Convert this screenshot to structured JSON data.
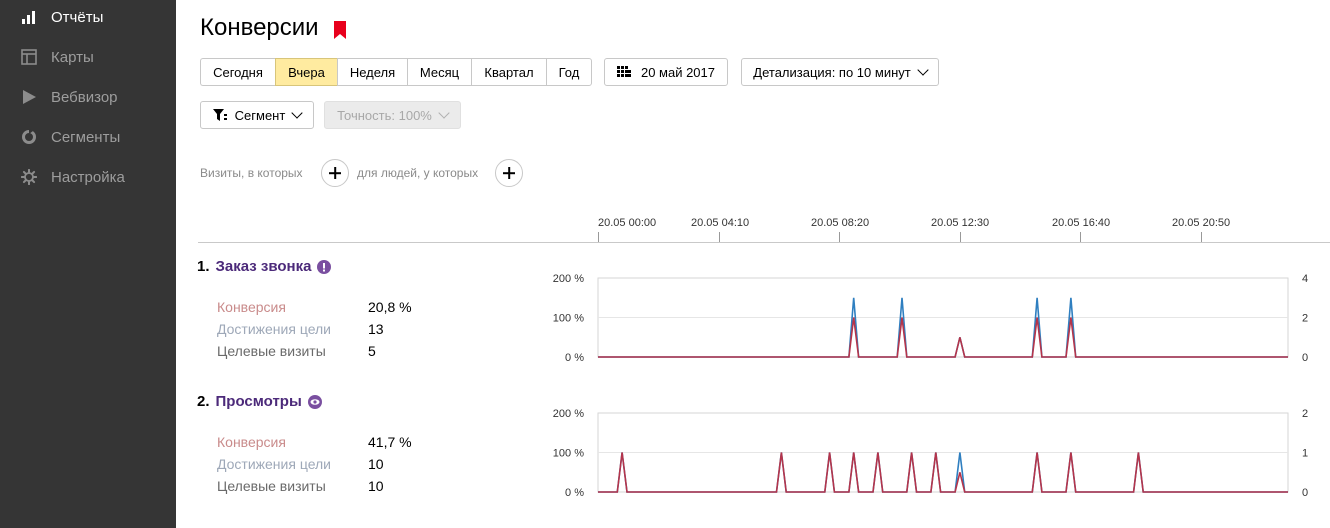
{
  "sidebar": {
    "items": [
      {
        "label": "Отчёты",
        "icon": "bar-chart-icon",
        "active": true
      },
      {
        "label": "Карты",
        "icon": "map-layout-icon",
        "active": false
      },
      {
        "label": "Вебвизор",
        "icon": "play-icon",
        "active": false
      },
      {
        "label": "Сегменты",
        "icon": "pie-segment-icon",
        "active": false
      },
      {
        "label": "Настройка",
        "icon": "gear-icon",
        "active": false
      }
    ]
  },
  "header": {
    "title": "Конверсии",
    "bookmark_icon": "bookmark-icon",
    "bookmark_color": "#e8001c"
  },
  "period": {
    "options": [
      "Сегодня",
      "Вчера",
      "Неделя",
      "Месяц",
      "Квартал",
      "Год"
    ],
    "selected": "Вчера",
    "date_label": "20 май 2017",
    "date_icon": "calendar-icon",
    "detail_label": "Детализация: по 10 минут"
  },
  "segment": {
    "label": "Сегмент",
    "icon": "funnel-icon",
    "accuracy_label": "Точность: 100%"
  },
  "filters": {
    "visits_label": "Визиты, в которых",
    "people_label": "для людей, у которых"
  },
  "timeline": {
    "labels": [
      "20.05 00:00",
      "20.05 04:10",
      "20.05 08:20",
      "20.05 12:30",
      "20.05 16:40",
      "20.05 20:50"
    ]
  },
  "colors": {
    "accent_selected": "#ffeba0",
    "goal_title": "#4c2a7a",
    "conversion_line": "#b5344a",
    "visits_line": "#2f7fc0"
  },
  "goals": [
    {
      "index": "1.",
      "name": "Заказ звонка",
      "icon": "exclamation-circle-icon",
      "metrics": [
        {
          "label": "Конверсия",
          "value": "20,8 %"
        },
        {
          "label": "Достижения цели",
          "value": "13"
        },
        {
          "label": "Целевые визиты",
          "value": "5"
        }
      ]
    },
    {
      "index": "2.",
      "name": "Просмотры",
      "icon": "eye-icon",
      "metrics": [
        {
          "label": "Конверсия",
          "value": "41,7 %"
        },
        {
          "label": "Достижения цели",
          "value": "10"
        },
        {
          "label": "Целевые визиты",
          "value": "10"
        }
      ]
    }
  ],
  "chart_data": [
    {
      "type": "line",
      "x_unit": "10-minute interval index of 20.05 (0 = 00:00)",
      "x_range": [
        0,
        143
      ],
      "left_axis": {
        "ticks": [
          "200 %",
          "100 %",
          "0 %"
        ],
        "range": [
          0,
          200
        ]
      },
      "right_axis": {
        "ticks": [
          "4",
          "2",
          "0"
        ],
        "range": [
          0,
          4
        ]
      },
      "series": [
        {
          "axis": "right",
          "color": "#2f7fc0",
          "points": [
            [
              53,
              3
            ],
            [
              63,
              3
            ],
            [
              75,
              1
            ],
            [
              91,
              3
            ],
            [
              98,
              3
            ]
          ]
        },
        {
          "axis": "right",
          "color": "#b5344a",
          "points": [
            [
              53,
              2
            ],
            [
              63,
              2
            ],
            [
              75,
              1
            ],
            [
              91,
              2
            ],
            [
              98,
              2
            ]
          ]
        }
      ]
    },
    {
      "type": "line",
      "x_unit": "10-minute interval index of 20.05 (0 = 00:00)",
      "x_range": [
        0,
        143
      ],
      "left_axis": {
        "ticks": [
          "200 %",
          "100 %",
          "0 %"
        ],
        "range": [
          0,
          200
        ]
      },
      "right_axis": {
        "ticks": [
          "2",
          "1",
          "0"
        ],
        "range": [
          0,
          2
        ]
      },
      "series": [
        {
          "axis": "right",
          "color": "#2f7fc0",
          "points": [
            [
              5,
              1
            ],
            [
              38,
              1
            ],
            [
              48,
              1
            ],
            [
              53,
              1
            ],
            [
              58,
              1
            ],
            [
              65,
              1
            ],
            [
              70,
              1
            ],
            [
              75,
              1
            ],
            [
              91,
              1
            ],
            [
              98,
              1
            ],
            [
              112,
              1
            ]
          ]
        },
        {
          "axis": "right",
          "color": "#b5344a",
          "points": [
            [
              5,
              1
            ],
            [
              38,
              1
            ],
            [
              48,
              1
            ],
            [
              53,
              1
            ],
            [
              58,
              1
            ],
            [
              65,
              1
            ],
            [
              70,
              1
            ],
            [
              75,
              0.5
            ],
            [
              91,
              1
            ],
            [
              98,
              1
            ],
            [
              112,
              1
            ]
          ]
        }
      ]
    }
  ]
}
